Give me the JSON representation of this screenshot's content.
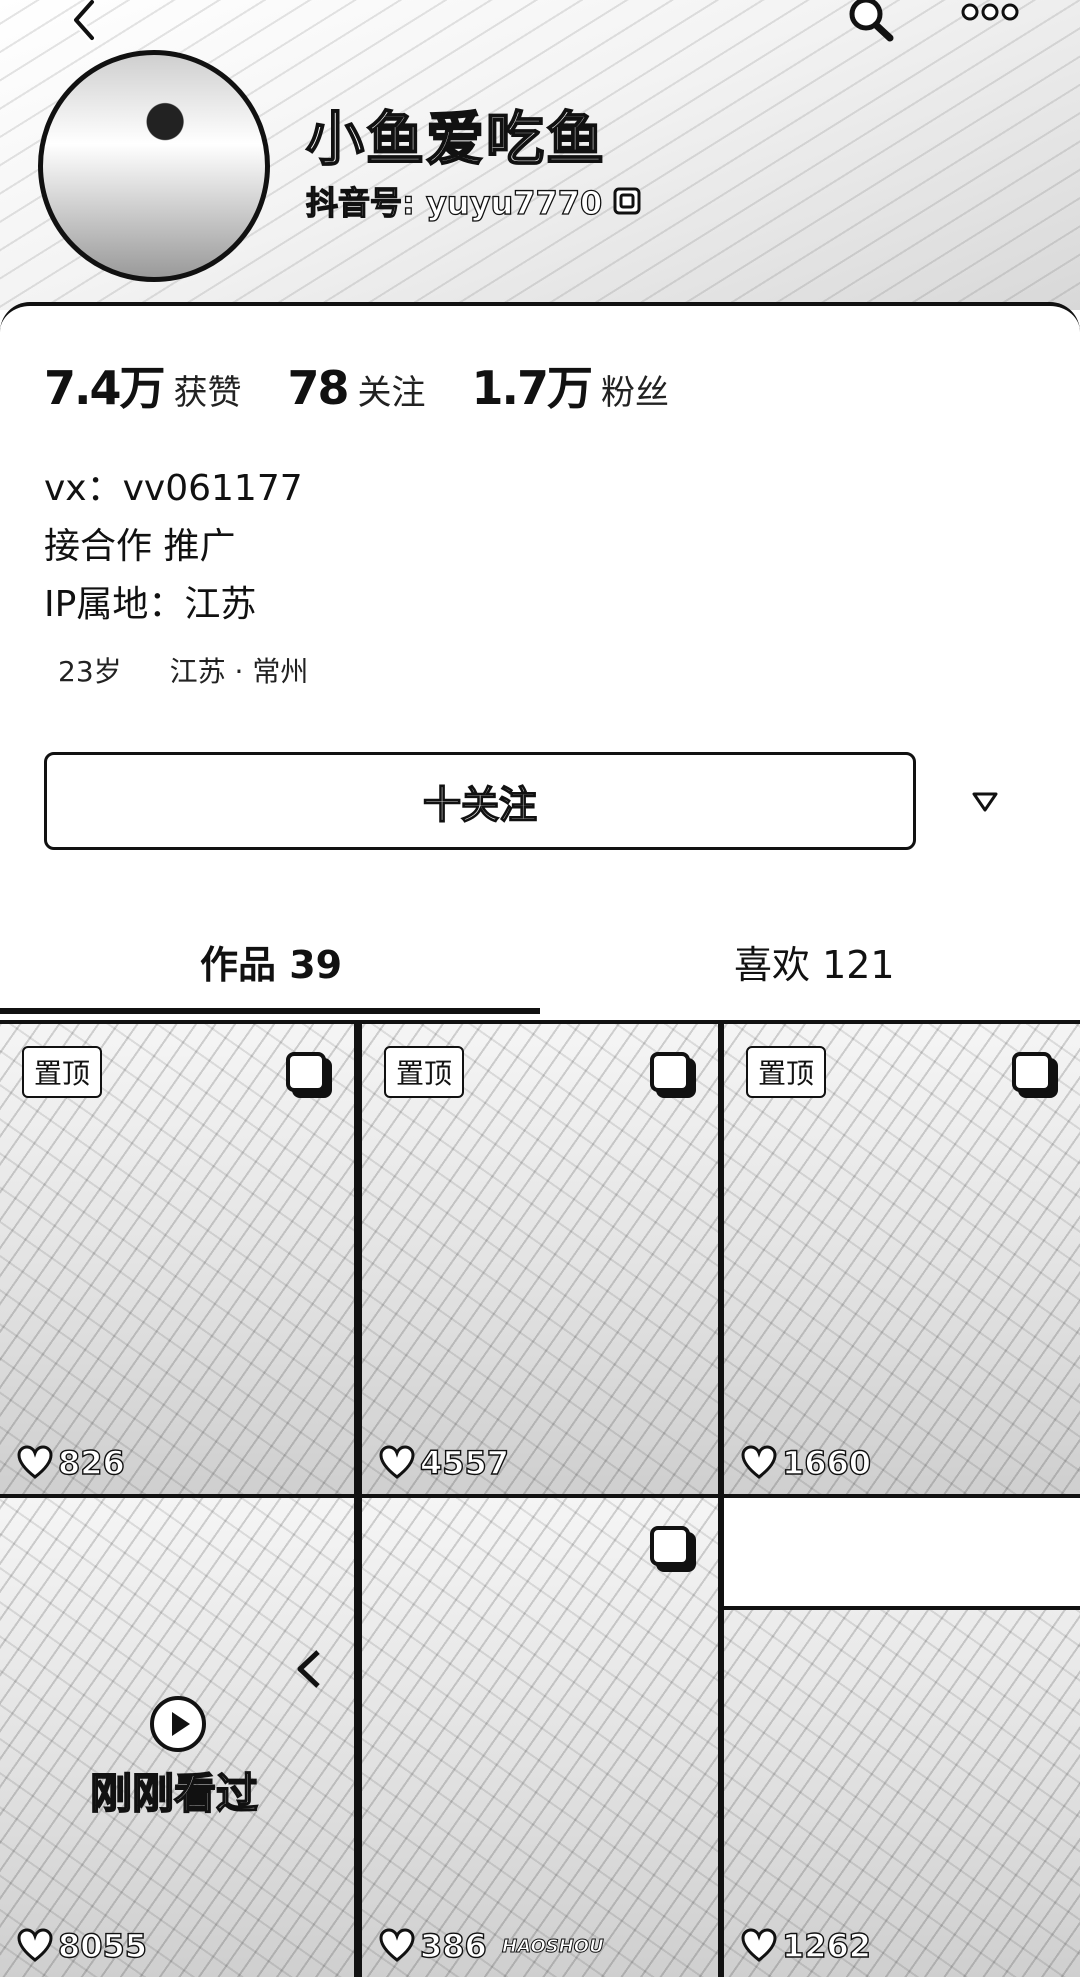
{
  "header": {
    "nickname": "小鱼爱吃鱼",
    "douyin_id": "抖音号: yuyu7770",
    "icons": [
      "back-icon",
      "search-icon",
      "more-icon",
      "qr-code-icon"
    ]
  },
  "stats": [
    {
      "num": "7.4万",
      "label": "获赞"
    },
    {
      "num": "78",
      "label": "关注"
    },
    {
      "num": "1.7万",
      "label": "粉丝"
    }
  ],
  "bio": [
    "vx：vv061177",
    "接合作 推广",
    "IP属地：江苏"
  ],
  "tags": [
    "23岁",
    "江苏 · 常州"
  ],
  "follow_button": "十关注",
  "tabs": [
    {
      "label": "作品 39",
      "active": true
    },
    {
      "label": "喜欢 121",
      "active": false
    }
  ],
  "videos": [
    {
      "pinned": true,
      "pin_label": "置顶",
      "likes": "826"
    },
    {
      "pinned": true,
      "pin_label": "置顶",
      "likes": "4557"
    },
    {
      "pinned": true,
      "pin_label": "置顶",
      "likes": "1660"
    },
    {
      "pinned": false,
      "likes": "8055",
      "overlay": "刚刚看过"
    },
    {
      "pinned": false,
      "likes": "386",
      "watermark": "HAOSHOU"
    },
    {
      "pinned": false,
      "likes": "1262"
    }
  ]
}
